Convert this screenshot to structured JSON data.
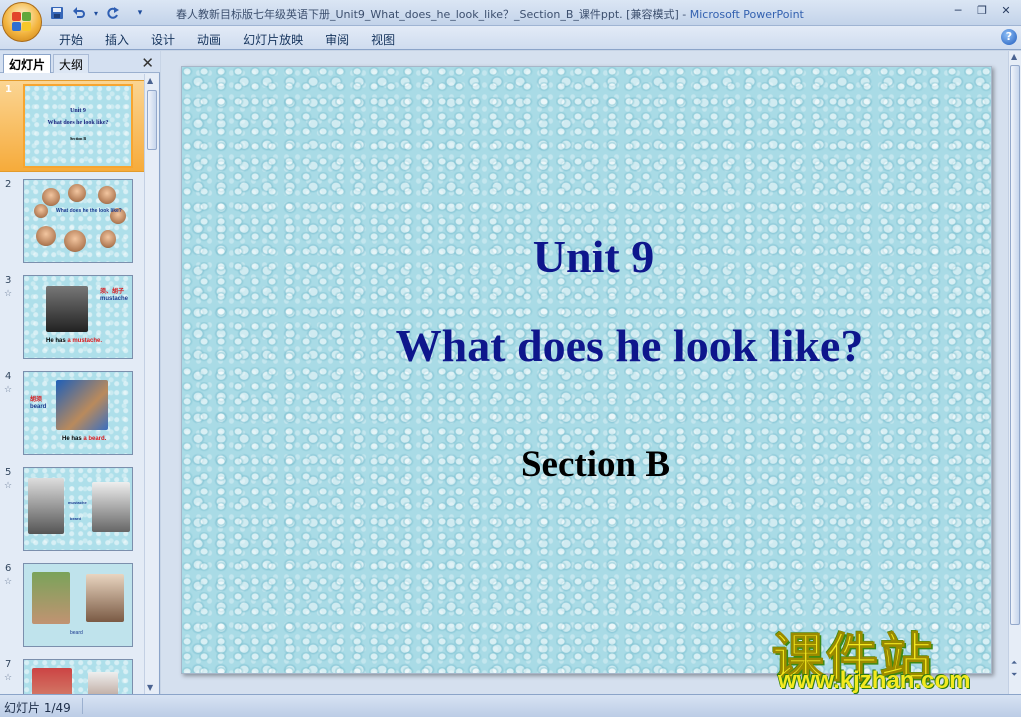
{
  "window": {
    "title": "春人教新目标版七年级英语下册_Unit9_What_does_he_look_like？_Section_B_课件ppt. [兼容模式]",
    "separator": " - ",
    "app_name": "Microsoft PowerPoint"
  },
  "ribbon": {
    "tabs": [
      "开始",
      "插入",
      "设计",
      "动画",
      "幻灯片放映",
      "审阅",
      "视图"
    ]
  },
  "panel": {
    "tab_slides": "幻灯片",
    "tab_outline": "大纲"
  },
  "thumbnails": [
    {
      "num": "1",
      "star": "",
      "line1": "Unit 9",
      "line2": "What does he look like?",
      "line3": "Section B"
    },
    {
      "num": "2",
      "star": "",
      "text": "What does he the look like?"
    },
    {
      "num": "3",
      "star": "☆",
      "label_cn": "须、胡子",
      "label_en": "mustache",
      "caption": "He has ",
      "caption_red": "a mustache."
    },
    {
      "num": "4",
      "star": "☆",
      "label_cn": "胡须",
      "label_en": "beard",
      "caption": "He has ",
      "caption_red": "a beard."
    },
    {
      "num": "5",
      "star": "☆",
      "label_a": "mustache",
      "label_b": "beard"
    },
    {
      "num": "6",
      "star": "☆",
      "caption": "beard"
    },
    {
      "num": "7",
      "star": "☆"
    }
  ],
  "slide": {
    "title": "Unit 9",
    "question": "What does he look like?",
    "section": "Section B"
  },
  "watermark": {
    "brand": "课件站",
    "url": "www.kjzhan.com"
  },
  "status": {
    "slide_counter": "幻灯片 1/49"
  },
  "colors": {
    "slide_title": "#0e168c",
    "slide_bg": "#a9dbe6",
    "selected_thumb": "#f6ab3b"
  }
}
